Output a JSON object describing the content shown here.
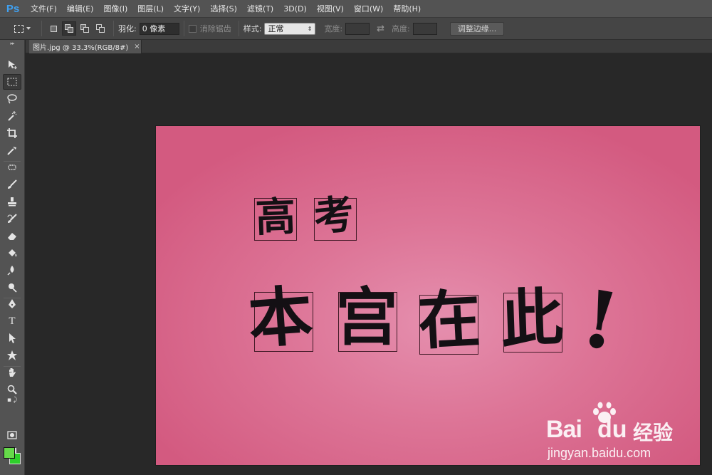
{
  "app": {
    "logo": "Ps"
  },
  "menu": [
    "文件(F)",
    "编辑(E)",
    "图像(I)",
    "图层(L)",
    "文字(Y)",
    "选择(S)",
    "滤镜(T)",
    "3D(D)",
    "视图(V)",
    "窗口(W)",
    "帮助(H)"
  ],
  "options": {
    "feather_label": "羽化:",
    "feather_value": "0 像素",
    "antialias_label": "消除锯齿",
    "style_label": "样式:",
    "style_value": "正常",
    "width_label": "宽度:",
    "height_label": "高度:",
    "refine_edge": "调整边缘..."
  },
  "document": {
    "tab_title": "图片.jpg @ 33.3%(RGB/8#)",
    "close": "×"
  },
  "canvas": {
    "line1": [
      "高",
      "考"
    ],
    "line2": [
      "本",
      "宫",
      "在",
      "此"
    ],
    "exclaim": "!"
  },
  "watermark": {
    "brand": "Bai",
    "brand2": "du",
    "brand_cn": "经验",
    "url": "jingyan.baidu.com"
  },
  "colors": {
    "foreground": "#66d94a",
    "background": "#2ecf2a",
    "canvas": "#dd7597"
  }
}
